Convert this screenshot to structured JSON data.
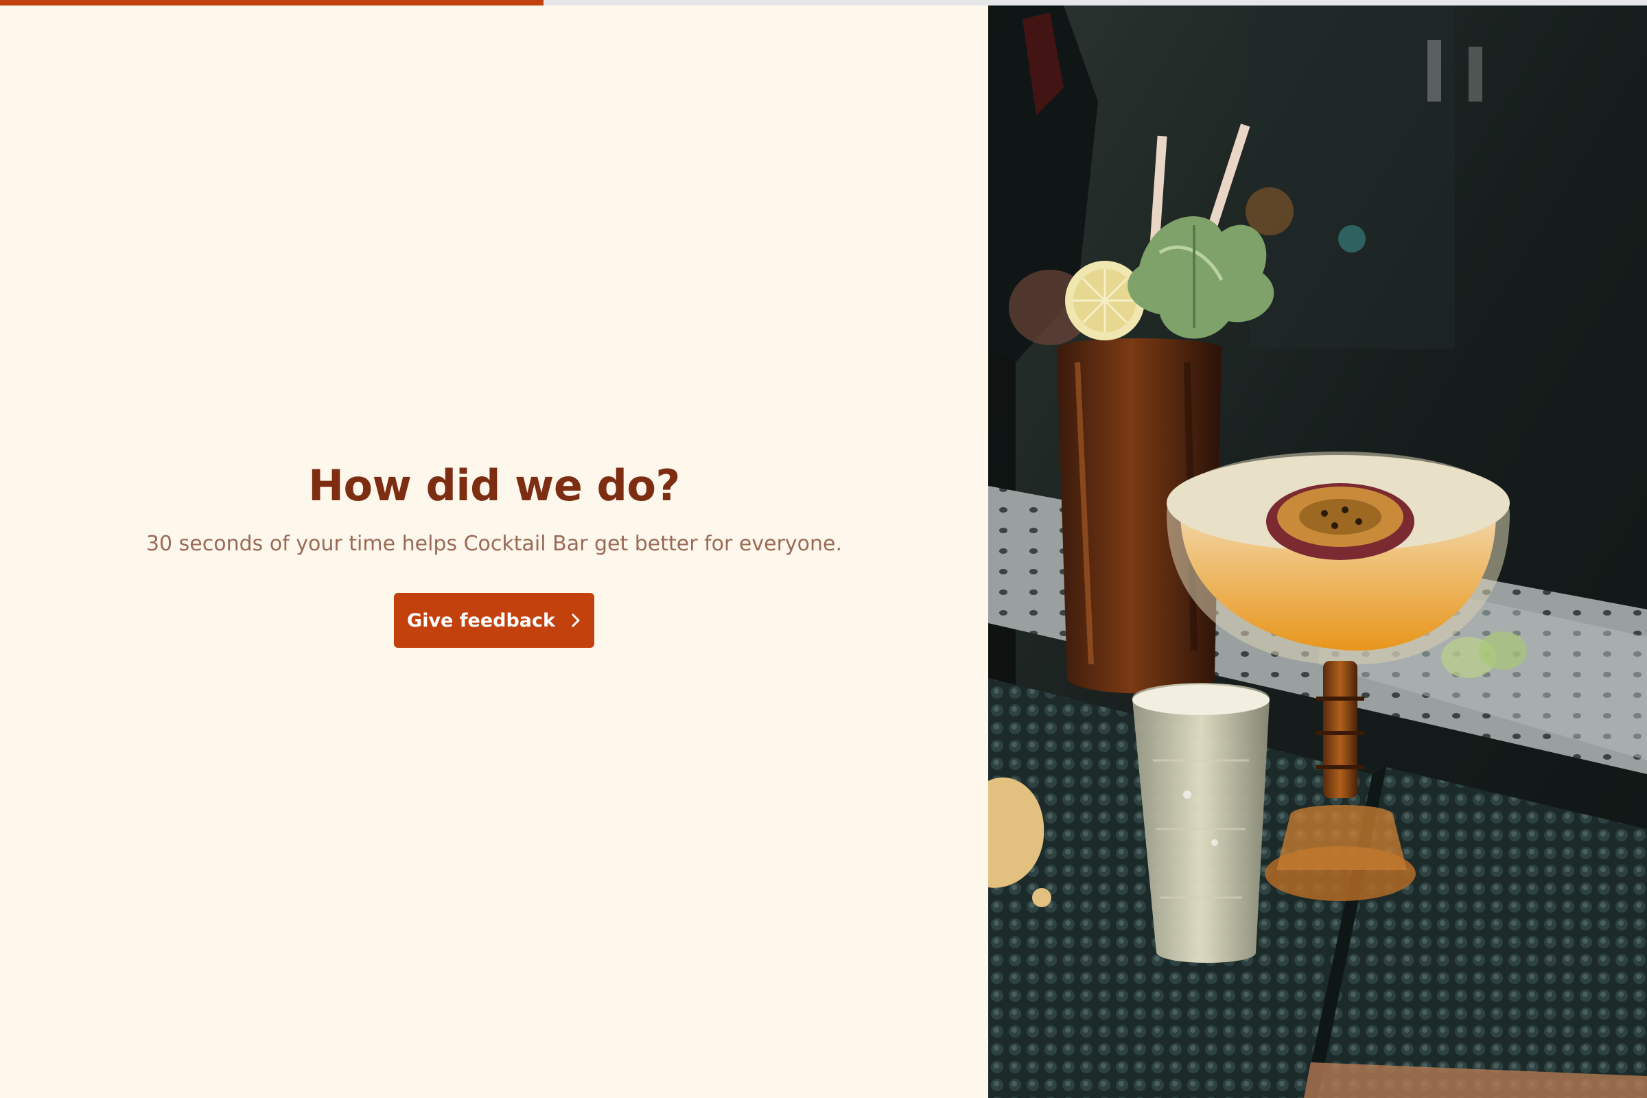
{
  "progress": {
    "fraction": 0.33,
    "track_color": "#e7e7ea",
    "fill_color": "#c2410c"
  },
  "intro": {
    "title": "How did we do?",
    "subtitle": "30 seconds of your time helps Cocktail Bar get better for everyone.",
    "button_label": "Give feedback",
    "button_icon": "chevron-right-icon"
  },
  "colors": {
    "background": "#fef7ec",
    "accent": "#c2410c",
    "title": "#7c2d12",
    "subtitle": "#9a6a56"
  },
  "hero_image": {
    "icon": "cocktail-photo"
  }
}
